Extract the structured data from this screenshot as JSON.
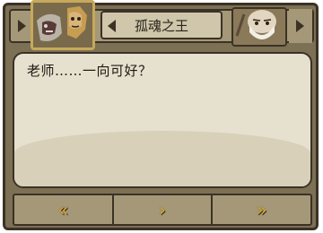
{
  "header": {
    "speaker_name": "孤魂之王",
    "left_portrait": "hero-portrait",
    "right_portrait": "old-bald-man-portrait"
  },
  "dialog": {
    "text": "老师……一向可好？"
  },
  "nav": {
    "prev_icon": "double-chevron-left-icon",
    "next_icon": "chevron-right-icon",
    "skip_icon": "double-chevron-right-icon"
  },
  "colors": {
    "frame": "#7c7055",
    "panel": "#e6e0cf",
    "accent_gold": "#d9ad3a",
    "border": "#3b3225"
  }
}
